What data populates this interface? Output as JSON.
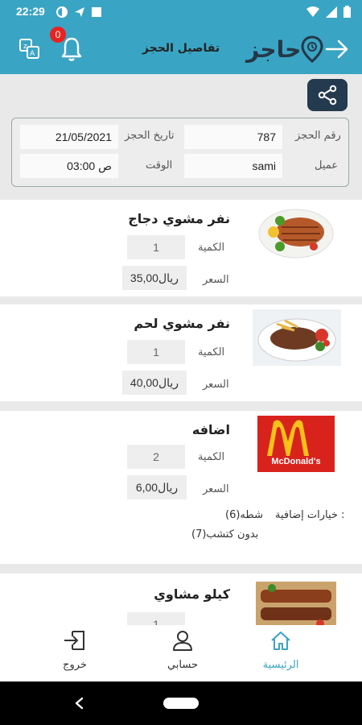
{
  "status_bar": {
    "time": "22:29"
  },
  "app_bar": {
    "title": "تفاصيل الحجز",
    "brand": "حاجز",
    "notification_count": "0"
  },
  "booking": {
    "number_label": "رقم الحجز",
    "number_value": "787",
    "date_label": "تاريخ الحجز",
    "date_value": "21/05/2021",
    "customer_label": "عميل",
    "customer_value": "sami",
    "time_label": "الوقت",
    "time_value": "03:00  ص"
  },
  "labels": {
    "qty": "الكمية",
    "price": "السعر"
  },
  "items": [
    {
      "name": "نفر مشوي دجاج",
      "qty": "1",
      "price": "35,00ريال",
      "image": "grilled-chicken-plate"
    },
    {
      "name": "نفر مشوي لحم",
      "qty": "1",
      "price": "40,00ريال",
      "image": "grilled-meat-plate"
    },
    {
      "name": "اضافه",
      "qty": "2",
      "price": "6,00ريال",
      "image": "mcdonalds-logo",
      "extras_label": "خيارات إضافية :",
      "extras": [
        "شطه(6)",
        "بدون كتشب(7)"
      ]
    },
    {
      "name": "كيلو مشاوي",
      "qty": "1",
      "price": "",
      "image": "grilled-meat-platter"
    }
  ],
  "logo_text": "McDonald's",
  "bottom_nav": {
    "home": "الرئيسية",
    "account": "حسابي",
    "logout": "خروج"
  },
  "colors": {
    "primary": "#3aa4c4",
    "dark": "#243a4f",
    "badge": "#e8231f",
    "active_nav": "#3aa4c4"
  }
}
